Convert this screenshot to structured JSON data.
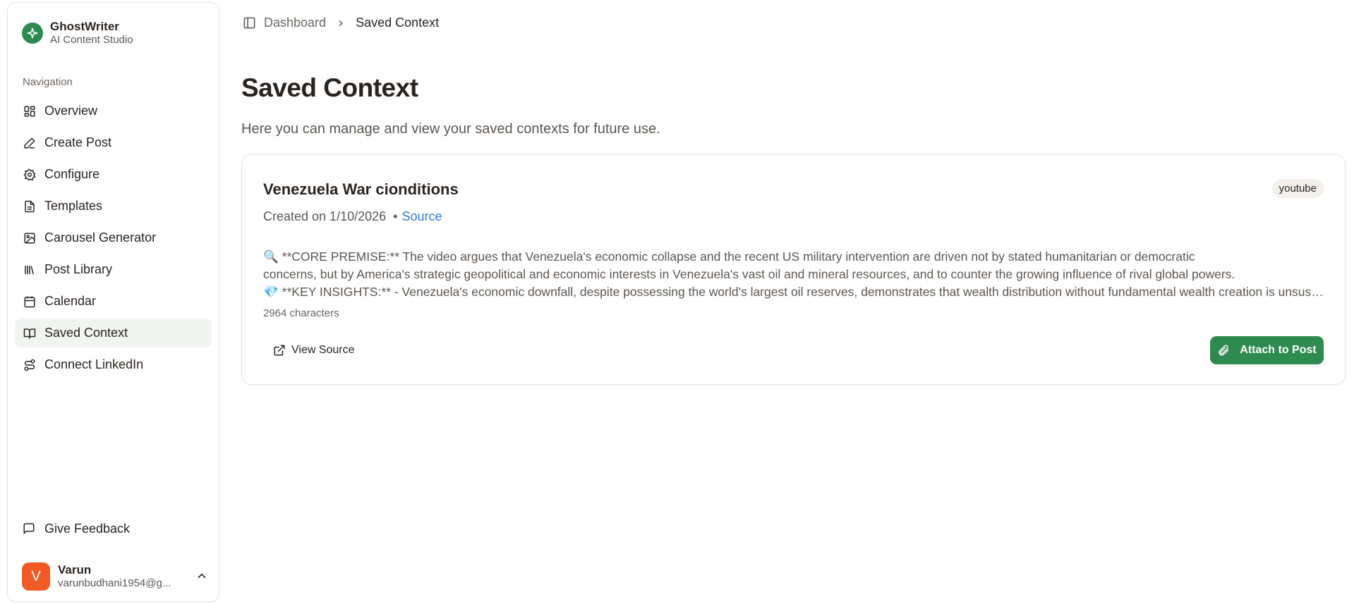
{
  "brand": {
    "name": "GhostWriter",
    "subtitle": "AI Content Studio",
    "accent": "#2e8b4f"
  },
  "sidebar": {
    "section_label": "Navigation",
    "items": [
      {
        "label": "Overview",
        "icon": "grid-icon"
      },
      {
        "label": "Create Post",
        "icon": "pen-icon"
      },
      {
        "label": "Configure",
        "icon": "gear-icon"
      },
      {
        "label": "Templates",
        "icon": "document-icon"
      },
      {
        "label": "Carousel Generator",
        "icon": "image-icon"
      },
      {
        "label": "Post Library",
        "icon": "library-icon"
      },
      {
        "label": "Calendar",
        "icon": "calendar-icon"
      },
      {
        "label": "Saved Context",
        "icon": "book-open-icon",
        "active": true
      },
      {
        "label": "Connect LinkedIn",
        "icon": "route-icon"
      }
    ],
    "feedback_label": "Give Feedback",
    "user": {
      "initial": "V",
      "name": "Varun",
      "email": "varunbudhani1954@g...",
      "avatar_color": "#f15a24"
    }
  },
  "breadcrumb": {
    "parent": "Dashboard",
    "current": "Saved Context"
  },
  "page": {
    "title": "Saved Context",
    "subtitle": "Here you can manage and view your saved contexts for future use."
  },
  "contexts": [
    {
      "title": "Venezuela War cionditions",
      "tag": "youtube",
      "created": "Created on 1/10/2026",
      "source_link": "Source",
      "summary_lines": [
        "🔍 **CORE PREMISE:** The video argues that Venezuela's economic collapse and the recent US military intervention are driven not by stated humanitarian or democratic",
        "concerns, but by America's strategic geopolitical and economic interests in Venezuela's vast oil and mineral resources, and to counter the growing influence of rival global powers.",
        "💎 **KEY INSIGHTS:** - Venezuela's economic downfall, despite possessing the world's largest oil reserves, demonstrates that wealth distribution without fundamental wealth creation is unsustainable"
      ],
      "char_count": "2964 characters",
      "view_source_label": "View Source",
      "attach_label": "Attach to Post"
    }
  ]
}
